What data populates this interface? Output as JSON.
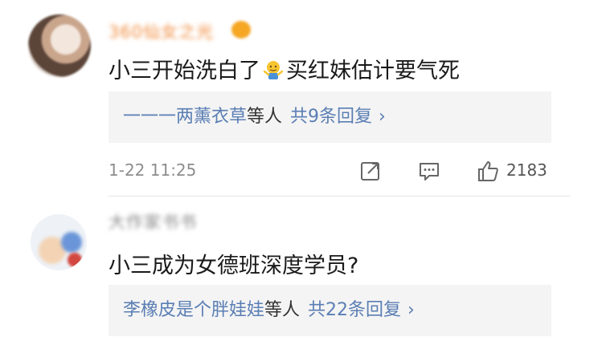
{
  "comments": [
    {
      "username": "360仙女之光",
      "text_before": "小三开始洗白了",
      "emoji": "shrug-emoji",
      "text_after": "买红妹估计要气死",
      "reply_names": "一一一两薰衣草",
      "reply_suffix": "等人",
      "reply_count": "共9条回复",
      "timestamp": "1-22 11:25",
      "likes": "2183"
    },
    {
      "username": "大作家书书",
      "text": "小三成为女德班深度学员?",
      "reply_names": "李橡皮是个胖娃娃",
      "reply_suffix": "等人",
      "reply_count": "共22条回复"
    }
  ],
  "icons": {
    "share": "share-icon",
    "comment": "comment-icon",
    "like": "thumbs-up-icon",
    "chevron": "chevron-right-icon"
  },
  "colors": {
    "link_blue": "#5a7eb4",
    "username_orange": "#f08a3a",
    "reply_bg": "#f4f4f4",
    "meta_gray": "#8d8d8d"
  }
}
